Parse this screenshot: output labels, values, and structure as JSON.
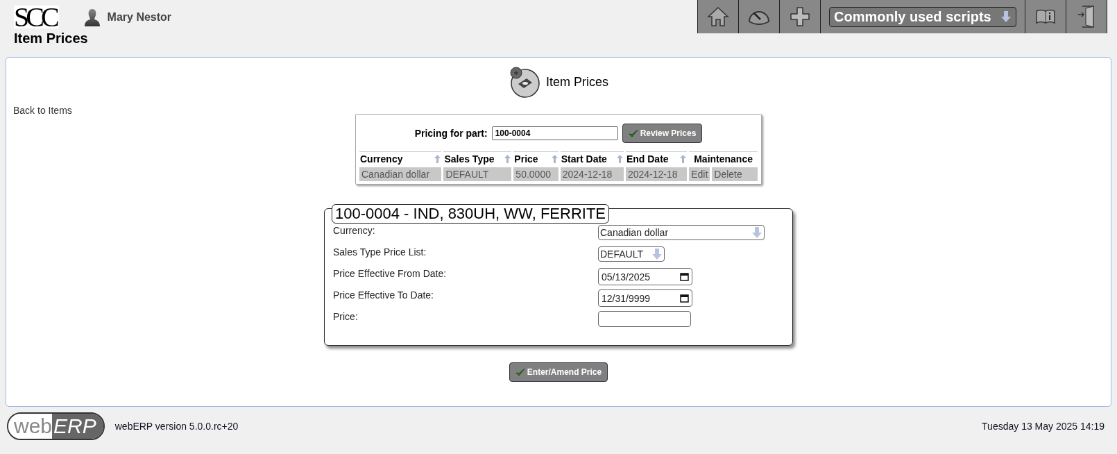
{
  "header": {
    "logo": "SCC",
    "user": "Mary Nestor",
    "page_title": "Item Prices",
    "scripts_menu": "Commonly used scripts"
  },
  "back_link": "Back to Items",
  "heading": "Item Prices",
  "search": {
    "label": "Pricing for part:",
    "value": "100-0004",
    "button": "Review Prices"
  },
  "table": {
    "columns": [
      {
        "label": "Currency",
        "sortable": true
      },
      {
        "label": "Sales Type",
        "sortable": true
      },
      {
        "label": "Price",
        "sortable": true
      },
      {
        "label": "Start Date",
        "sortable": true
      },
      {
        "label": "End Date",
        "sortable": true
      },
      {
        "label": "Maintenance",
        "sortable": false
      }
    ],
    "rows": [
      {
        "cells": [
          "Canadian dollar",
          "DEFAULT",
          "50.0000",
          "2024-12-18",
          "2024-12-18"
        ],
        "actions": [
          "Edit",
          "Delete"
        ]
      }
    ]
  },
  "form": {
    "legend": "100-0004 - IND, 830UH, WW, FERRITE",
    "fields": [
      {
        "kind": "select",
        "label": "Currency:",
        "value": "Canadian dollar",
        "wide": true
      },
      {
        "kind": "select",
        "label": "Sales Type Price List:",
        "value": "DEFAULT",
        "wide": false
      },
      {
        "kind": "date",
        "label": "Price Effective From Date:",
        "value": "05/13/2025"
      },
      {
        "kind": "date",
        "label": "Price Effective To Date:",
        "value": "12/31/9999"
      },
      {
        "kind": "text",
        "label": "Price:"
      }
    ],
    "submit": "Enter/Amend Price"
  },
  "footer": {
    "logo_left": "web",
    "logo_right": "ERP",
    "version": "webERP version 5.0.0.rc+20",
    "datetime": "Tuesday 13 May 2025 14:19"
  }
}
